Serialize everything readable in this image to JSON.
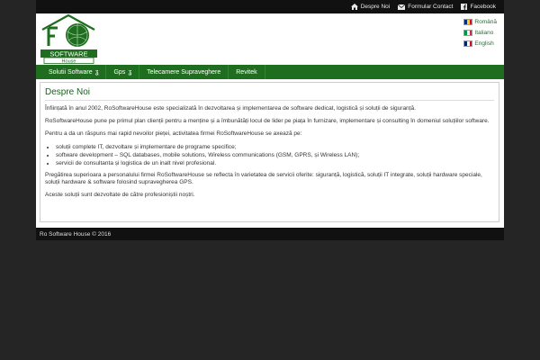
{
  "topbar": {
    "links": [
      {
        "label": "Despre Noi",
        "icon": "home-icon"
      },
      {
        "label": "Formular Contact",
        "icon": "envelope-icon"
      },
      {
        "label": "Facebook",
        "icon": "facebook-icon"
      }
    ]
  },
  "header": {
    "logo_line1": "SOFTWARE",
    "logo_line2": "House",
    "languages": [
      {
        "label": "Română",
        "flag": [
          "#002b7f",
          "#fcd116",
          "#ce1126"
        ]
      },
      {
        "label": "Italiano",
        "flag": [
          "#009246",
          "#ffffff",
          "#ce2b37"
        ]
      },
      {
        "label": "English",
        "flag": [
          "#012169",
          "#ffffff",
          "#c8102e"
        ]
      }
    ]
  },
  "nav": {
    "items": [
      {
        "label": "Solutii Software",
        "chevron": "ʓ"
      },
      {
        "label": "Gps",
        "chevron": "ʓ"
      },
      {
        "label": "Telecamere Supraveghere",
        "chevron": ""
      },
      {
        "label": "Revitek",
        "chevron": ""
      }
    ]
  },
  "content": {
    "title": "Despre Noi",
    "p1": "Înființată în anul 2002, RoSoftwareHouse este specializată în dezvoltarea și implementarea de software dedicat, logistică și soluții de siguranță.",
    "p2": "RoSoftwareHouse pune pe primul plan clienții pentru a menține și a îmbunătăți locul de lider pe piața în furnizare, implementare și consulting în domeniul soluțiilor software.",
    "p3": "Pentru a da un răspuns mai rapid nevoilor pieței, activitatea firmei RoSoftwareHouse se axează pe:",
    "bullets": [
      "soluții complete IT, dezvoltare și implementare de programe specifice;",
      "software development – SQL databases, mobile solutions, Wireless communications (GSM, GPRS, și Wireless LAN);",
      "servicii de consultanta și logistica de un inalt nivel profesional."
    ],
    "p4": "Pregătirea superioara a personalului firmei RoSoftwareHouse se reflecta în varietatea de servicii oferite: siguranță, logistică, soluții IT integrate, soluții hardware speciale, soluții hardware & software folosind supravegherea GPS.",
    "p5": "Aceste soluții sunt dezvoltate de către profesioniștii noștri."
  },
  "footer": {
    "text": "Ro Software House © 2016"
  },
  "colors": {
    "brand_green": "#1f6e1f",
    "dark_bg": "#252525"
  }
}
